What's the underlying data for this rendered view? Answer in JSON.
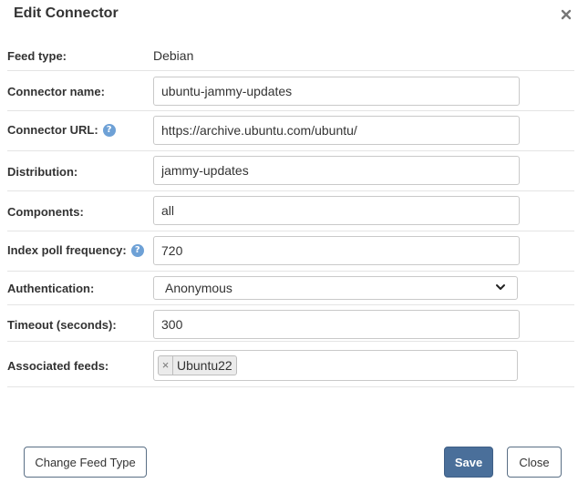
{
  "dialog": {
    "title": "Edit Connector"
  },
  "fields": {
    "feed_type": {
      "label": "Feed type:",
      "value": "Debian"
    },
    "connector_name": {
      "label": "Connector name:",
      "value": "ubuntu-jammy-updates"
    },
    "connector_url": {
      "label": "Connector URL:",
      "value": "https://archive.ubuntu.com/ubuntu/",
      "help": "?"
    },
    "distribution": {
      "label": "Distribution:",
      "value": "jammy-updates"
    },
    "components": {
      "label": "Components:",
      "value": "all"
    },
    "index_poll_frequency": {
      "label": "Index poll frequency:",
      "value": "720",
      "help": "?"
    },
    "authentication": {
      "label": "Authentication:",
      "value": "Anonymous"
    },
    "timeout": {
      "label": "Timeout (seconds):",
      "value": "300"
    },
    "associated_feeds": {
      "label": "Associated feeds:",
      "tags": [
        "Ubuntu22"
      ],
      "remove_glyph": "×"
    }
  },
  "buttons": {
    "change_feed_type": "Change Feed Type",
    "save": "Save",
    "close": "Close"
  },
  "colors": {
    "primary": "#4a6f9a",
    "help_icon": "#6ea1d6",
    "border": "#c9c9c9"
  },
  "icons": {
    "close": "close-icon",
    "help": "question-circle-icon",
    "dropdown": "chevron-down-icon"
  }
}
